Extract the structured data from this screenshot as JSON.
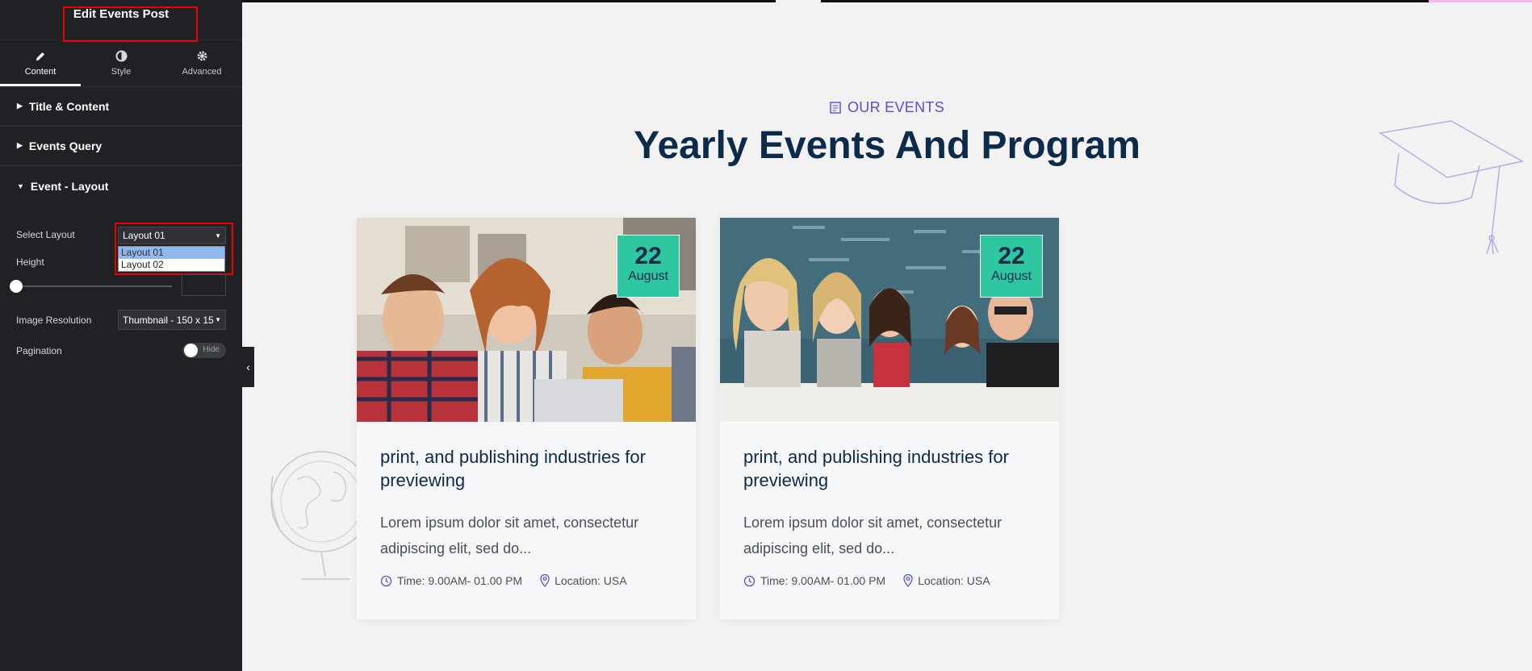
{
  "panel": {
    "title": "Edit Events Post",
    "tabs": [
      {
        "label": "Content",
        "icon": "pencil-icon"
      },
      {
        "label": "Style",
        "icon": "half-circle-icon"
      },
      {
        "label": "Advanced",
        "icon": "gear-icon"
      }
    ],
    "sections": [
      "Title & Content",
      "Events Query",
      "Event - Layout"
    ],
    "controls": {
      "select_layout_label": "Select Layout",
      "select_layout_value": "Layout 01",
      "layout_options": [
        "Layout 01",
        "Layout 02"
      ],
      "height_label": "Height",
      "height_value": "",
      "image_resolution_label": "Image Resolution",
      "image_resolution_value": "Thumbnail - 150 x 15",
      "pagination_label": "Pagination",
      "pagination_toggle": "Hide"
    }
  },
  "page": {
    "eyebrow": "OUR EVENTS",
    "headline": "Yearly Events And Program",
    "accent_color": "#5a4fd6",
    "badge_color": "#2fc7a0"
  },
  "events": [
    {
      "day": "22",
      "month": "August",
      "title": "print, and publishing industries for previewing",
      "excerpt": "Lorem ipsum dolor sit amet, consectetur adipiscing elit, sed do...",
      "time": "Time: 9.00AM- 01.00 PM",
      "location": "Location: USA"
    },
    {
      "day": "22",
      "month": "August",
      "title": "print, and publishing industries for previewing",
      "excerpt": "Lorem ipsum dolor sit amet, consectetur adipiscing elit, sed do...",
      "time": "Time: 9.00AM- 01.00 PM",
      "location": "Location: USA"
    }
  ]
}
